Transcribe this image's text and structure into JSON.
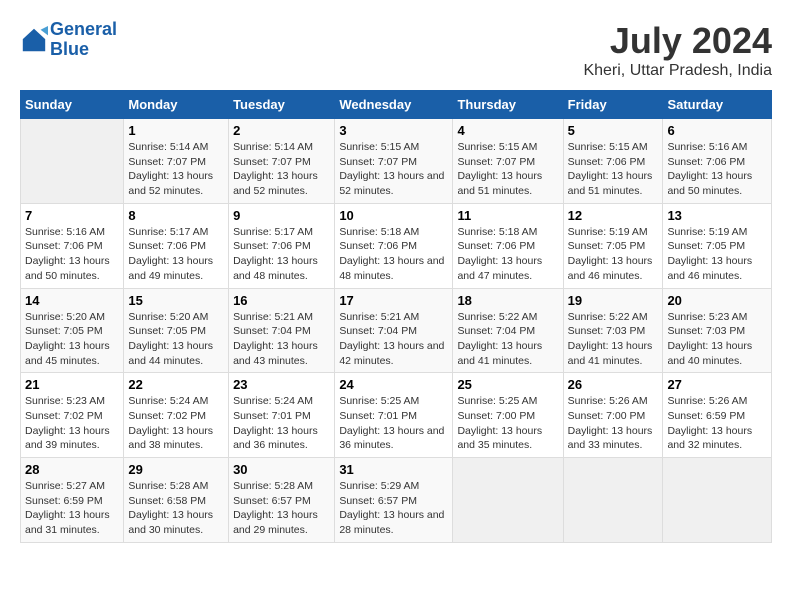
{
  "logo": {
    "line1": "General",
    "line2": "Blue"
  },
  "title": "July 2024",
  "subtitle": "Kheri, Uttar Pradesh, India",
  "header_days": [
    "Sunday",
    "Monday",
    "Tuesday",
    "Wednesday",
    "Thursday",
    "Friday",
    "Saturday"
  ],
  "weeks": [
    [
      {
        "day": "",
        "sunrise": "",
        "sunset": "",
        "daylight": ""
      },
      {
        "day": "1",
        "sunrise": "Sunrise: 5:14 AM",
        "sunset": "Sunset: 7:07 PM",
        "daylight": "Daylight: 13 hours and 52 minutes."
      },
      {
        "day": "2",
        "sunrise": "Sunrise: 5:14 AM",
        "sunset": "Sunset: 7:07 PM",
        "daylight": "Daylight: 13 hours and 52 minutes."
      },
      {
        "day": "3",
        "sunrise": "Sunrise: 5:15 AM",
        "sunset": "Sunset: 7:07 PM",
        "daylight": "Daylight: 13 hours and 52 minutes."
      },
      {
        "day": "4",
        "sunrise": "Sunrise: 5:15 AM",
        "sunset": "Sunset: 7:07 PM",
        "daylight": "Daylight: 13 hours and 51 minutes."
      },
      {
        "day": "5",
        "sunrise": "Sunrise: 5:15 AM",
        "sunset": "Sunset: 7:06 PM",
        "daylight": "Daylight: 13 hours and 51 minutes."
      },
      {
        "day": "6",
        "sunrise": "Sunrise: 5:16 AM",
        "sunset": "Sunset: 7:06 PM",
        "daylight": "Daylight: 13 hours and 50 minutes."
      }
    ],
    [
      {
        "day": "7",
        "sunrise": "Sunrise: 5:16 AM",
        "sunset": "Sunset: 7:06 PM",
        "daylight": "Daylight: 13 hours and 50 minutes."
      },
      {
        "day": "8",
        "sunrise": "Sunrise: 5:17 AM",
        "sunset": "Sunset: 7:06 PM",
        "daylight": "Daylight: 13 hours and 49 minutes."
      },
      {
        "day": "9",
        "sunrise": "Sunrise: 5:17 AM",
        "sunset": "Sunset: 7:06 PM",
        "daylight": "Daylight: 13 hours and 48 minutes."
      },
      {
        "day": "10",
        "sunrise": "Sunrise: 5:18 AM",
        "sunset": "Sunset: 7:06 PM",
        "daylight": "Daylight: 13 hours and 48 minutes."
      },
      {
        "day": "11",
        "sunrise": "Sunrise: 5:18 AM",
        "sunset": "Sunset: 7:06 PM",
        "daylight": "Daylight: 13 hours and 47 minutes."
      },
      {
        "day": "12",
        "sunrise": "Sunrise: 5:19 AM",
        "sunset": "Sunset: 7:05 PM",
        "daylight": "Daylight: 13 hours and 46 minutes."
      },
      {
        "day": "13",
        "sunrise": "Sunrise: 5:19 AM",
        "sunset": "Sunset: 7:05 PM",
        "daylight": "Daylight: 13 hours and 46 minutes."
      }
    ],
    [
      {
        "day": "14",
        "sunrise": "Sunrise: 5:20 AM",
        "sunset": "Sunset: 7:05 PM",
        "daylight": "Daylight: 13 hours and 45 minutes."
      },
      {
        "day": "15",
        "sunrise": "Sunrise: 5:20 AM",
        "sunset": "Sunset: 7:05 PM",
        "daylight": "Daylight: 13 hours and 44 minutes."
      },
      {
        "day": "16",
        "sunrise": "Sunrise: 5:21 AM",
        "sunset": "Sunset: 7:04 PM",
        "daylight": "Daylight: 13 hours and 43 minutes."
      },
      {
        "day": "17",
        "sunrise": "Sunrise: 5:21 AM",
        "sunset": "Sunset: 7:04 PM",
        "daylight": "Daylight: 13 hours and 42 minutes."
      },
      {
        "day": "18",
        "sunrise": "Sunrise: 5:22 AM",
        "sunset": "Sunset: 7:04 PM",
        "daylight": "Daylight: 13 hours and 41 minutes."
      },
      {
        "day": "19",
        "sunrise": "Sunrise: 5:22 AM",
        "sunset": "Sunset: 7:03 PM",
        "daylight": "Daylight: 13 hours and 41 minutes."
      },
      {
        "day": "20",
        "sunrise": "Sunrise: 5:23 AM",
        "sunset": "Sunset: 7:03 PM",
        "daylight": "Daylight: 13 hours and 40 minutes."
      }
    ],
    [
      {
        "day": "21",
        "sunrise": "Sunrise: 5:23 AM",
        "sunset": "Sunset: 7:02 PM",
        "daylight": "Daylight: 13 hours and 39 minutes."
      },
      {
        "day": "22",
        "sunrise": "Sunrise: 5:24 AM",
        "sunset": "Sunset: 7:02 PM",
        "daylight": "Daylight: 13 hours and 38 minutes."
      },
      {
        "day": "23",
        "sunrise": "Sunrise: 5:24 AM",
        "sunset": "Sunset: 7:01 PM",
        "daylight": "Daylight: 13 hours and 36 minutes."
      },
      {
        "day": "24",
        "sunrise": "Sunrise: 5:25 AM",
        "sunset": "Sunset: 7:01 PM",
        "daylight": "Daylight: 13 hours and 36 minutes."
      },
      {
        "day": "25",
        "sunrise": "Sunrise: 5:25 AM",
        "sunset": "Sunset: 7:00 PM",
        "daylight": "Daylight: 13 hours and 35 minutes."
      },
      {
        "day": "26",
        "sunrise": "Sunrise: 5:26 AM",
        "sunset": "Sunset: 7:00 PM",
        "daylight": "Daylight: 13 hours and 33 minutes."
      },
      {
        "day": "27",
        "sunrise": "Sunrise: 5:26 AM",
        "sunset": "Sunset: 6:59 PM",
        "daylight": "Daylight: 13 hours and 32 minutes."
      }
    ],
    [
      {
        "day": "28",
        "sunrise": "Sunrise: 5:27 AM",
        "sunset": "Sunset: 6:59 PM",
        "daylight": "Daylight: 13 hours and 31 minutes."
      },
      {
        "day": "29",
        "sunrise": "Sunrise: 5:28 AM",
        "sunset": "Sunset: 6:58 PM",
        "daylight": "Daylight: 13 hours and 30 minutes."
      },
      {
        "day": "30",
        "sunrise": "Sunrise: 5:28 AM",
        "sunset": "Sunset: 6:57 PM",
        "daylight": "Daylight: 13 hours and 29 minutes."
      },
      {
        "day": "31",
        "sunrise": "Sunrise: 5:29 AM",
        "sunset": "Sunset: 6:57 PM",
        "daylight": "Daylight: 13 hours and 28 minutes."
      },
      {
        "day": "",
        "sunrise": "",
        "sunset": "",
        "daylight": ""
      },
      {
        "day": "",
        "sunrise": "",
        "sunset": "",
        "daylight": ""
      },
      {
        "day": "",
        "sunrise": "",
        "sunset": "",
        "daylight": ""
      }
    ]
  ]
}
